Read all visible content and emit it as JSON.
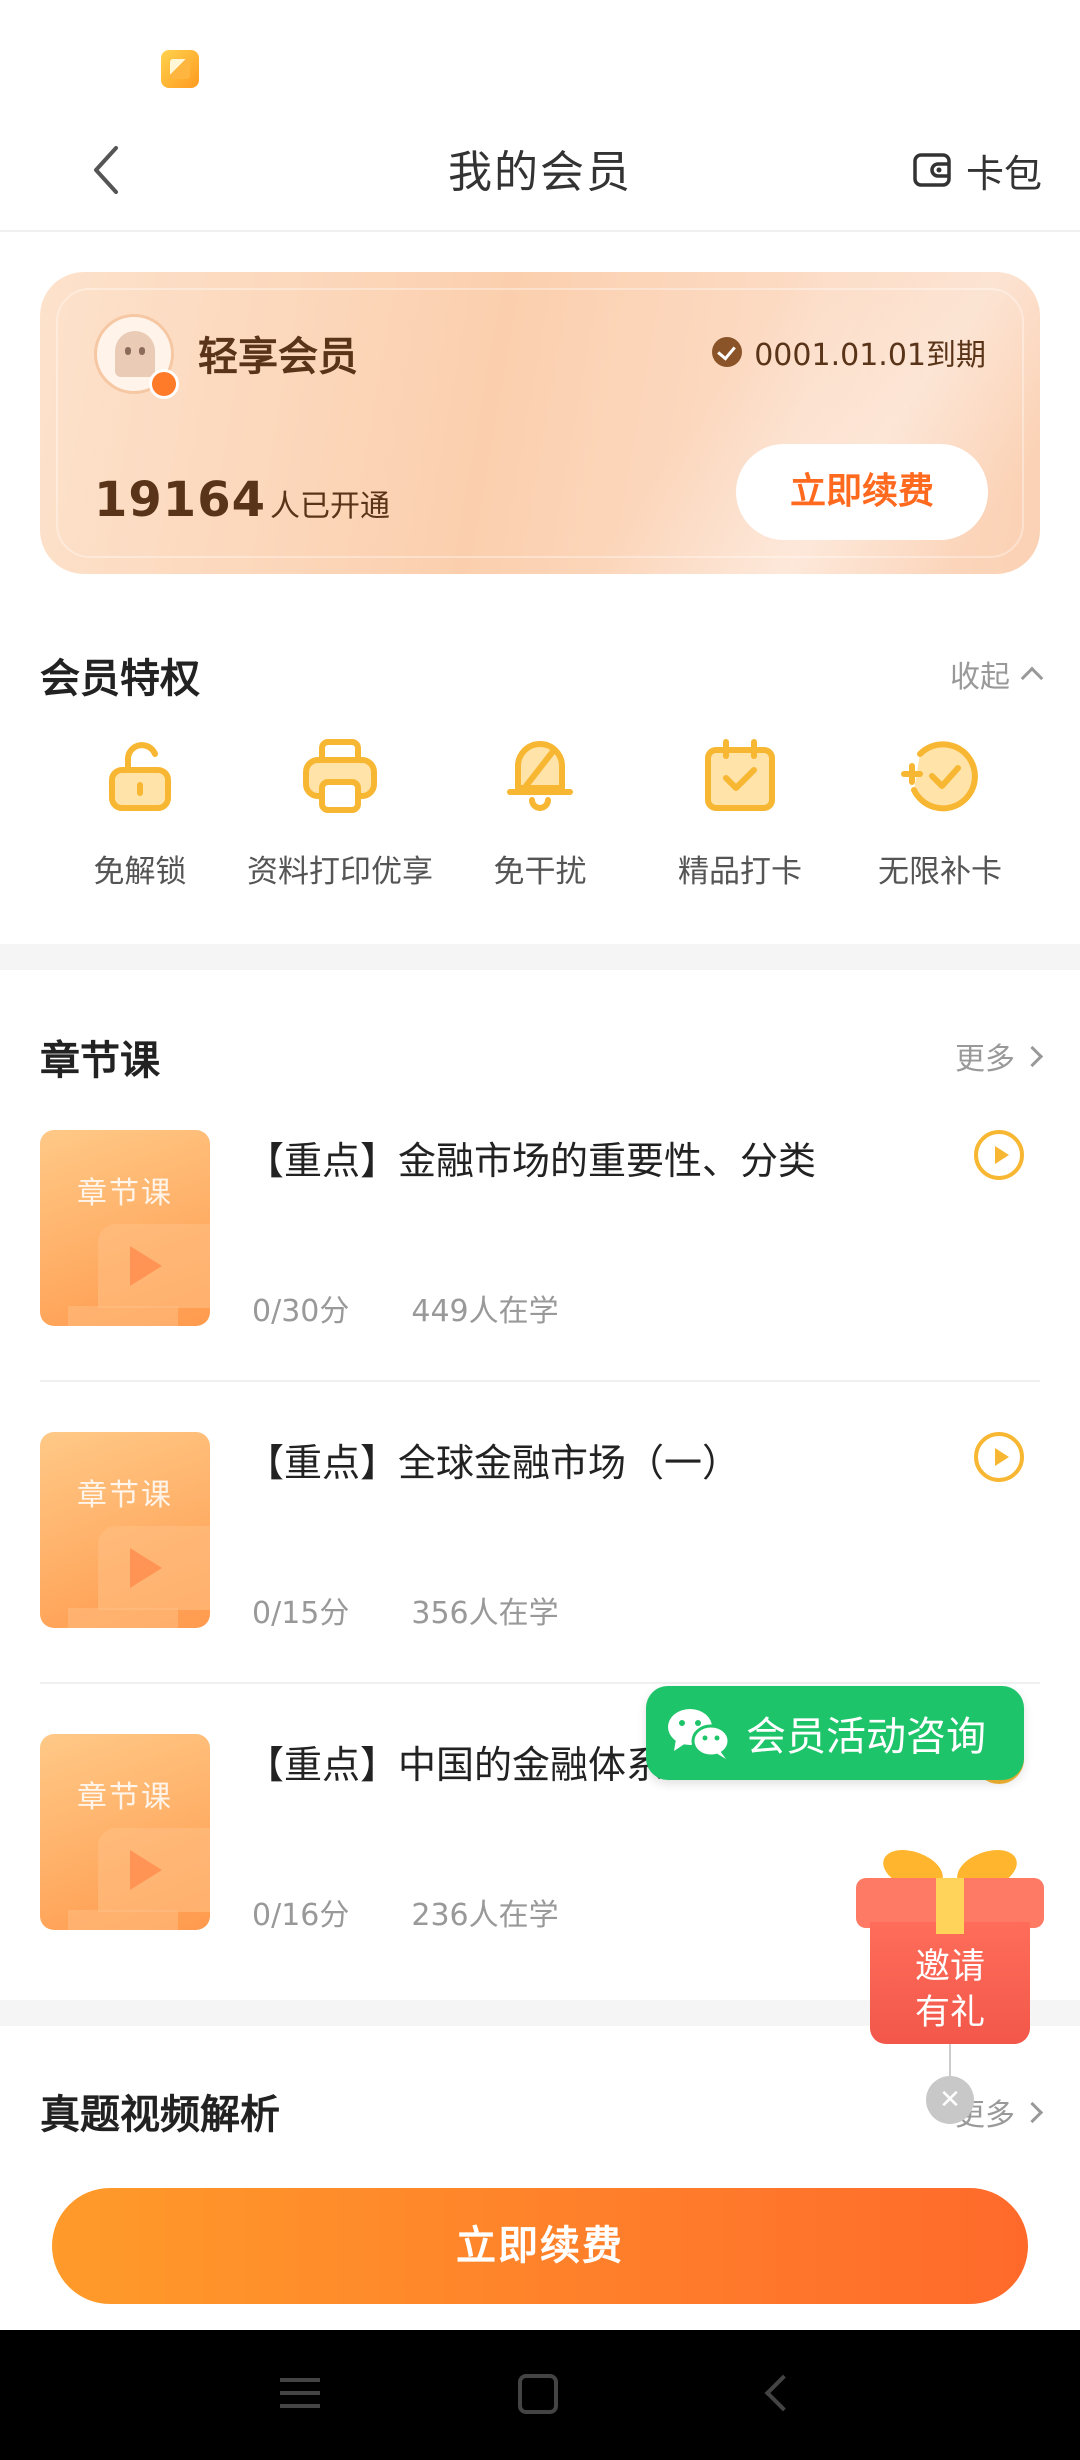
{
  "header": {
    "title": "我的会员",
    "wallet_label": "卡包"
  },
  "member_card": {
    "name": "轻享会员",
    "expiry": "0001.01.01到期",
    "count": "19164",
    "count_suffix": "人已开通",
    "renew_label": "立即续费"
  },
  "privileges": {
    "title": "会员特权",
    "collapse_label": "收起",
    "items": [
      {
        "label": "免解锁",
        "icon": "unlock-icon"
      },
      {
        "label": "资料打印优享",
        "icon": "printer-icon"
      },
      {
        "label": "免干扰",
        "icon": "mute-bell-icon"
      },
      {
        "label": "精品打卡",
        "icon": "calendar-check-icon"
      },
      {
        "label": "无限补卡",
        "icon": "add-check-icon"
      }
    ]
  },
  "chapters": {
    "title": "章节课",
    "more_label": "更多",
    "items": [
      {
        "thumb_label": "章节课",
        "title": "【重点】金融市场的重要性、分类",
        "score": "0/30分",
        "learners": "449人在学"
      },
      {
        "thumb_label": "章节课",
        "title": "【重点】全球金融市场（一）",
        "score": "0/15分",
        "learners": "356人在学"
      },
      {
        "thumb_label": "章节课",
        "title": "【重点】中国的金融体系",
        "score": "0/16分",
        "learners": "236人在学"
      }
    ]
  },
  "videos": {
    "title": "真题视频解析",
    "more_label": "更多"
  },
  "float_wechat": {
    "label": "会员活动咨询"
  },
  "float_invite": {
    "label_line1": "邀请",
    "label_line2": "有礼"
  },
  "bottom": {
    "renew_label": "立即续费"
  },
  "colors": {
    "accent": "#ff6a2b",
    "card_bg": "#fbcfae",
    "wechat": "#1dc46a",
    "icon": "#f7b733"
  }
}
